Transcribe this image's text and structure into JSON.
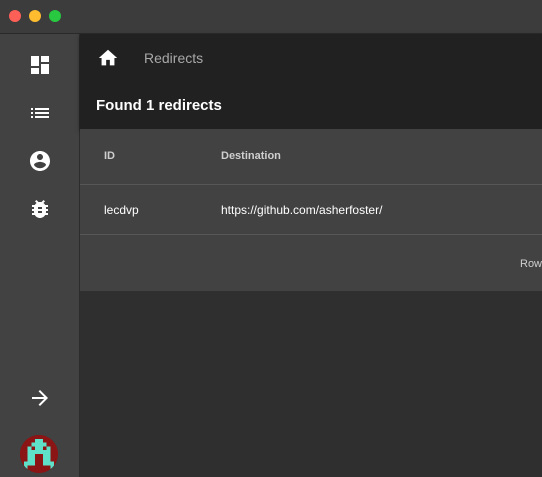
{
  "header": {
    "breadcrumb": "Redirects",
    "title": "Found 1 redirects"
  },
  "sidebar": {
    "items": [
      {
        "icon": "dashboard-icon"
      },
      {
        "icon": "list-icon"
      },
      {
        "icon": "account-icon"
      },
      {
        "icon": "bug-icon"
      }
    ],
    "logout_icon": "arrow-right-icon",
    "avatar_icon": "avatar"
  },
  "table": {
    "columns": [
      "ID",
      "Destination"
    ],
    "rows": [
      {
        "id": "lecdvp",
        "destination": "https://github.com/asherfoster/"
      }
    ],
    "footer": "Row"
  },
  "colors": {
    "sidebar": "#424242",
    "appbar": "#212121",
    "background": "#2f2f2f"
  }
}
